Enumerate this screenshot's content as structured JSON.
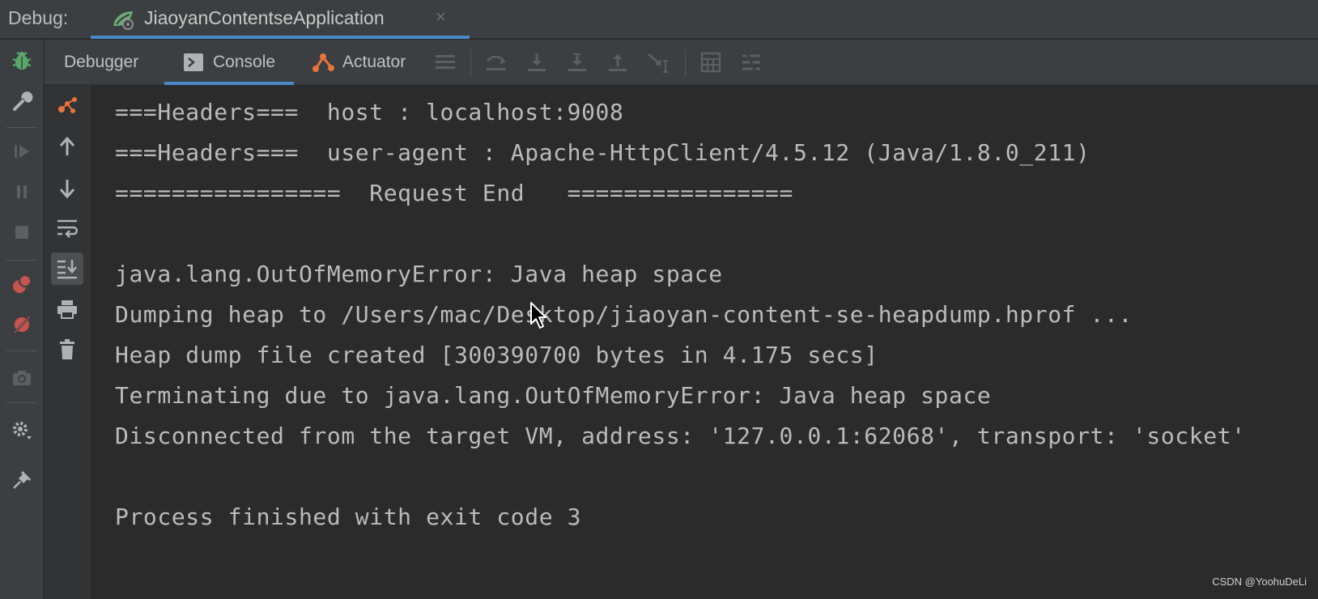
{
  "header": {
    "debug_label": "Debug:",
    "run_config": "JiaoyanContentseApplication",
    "close_symbol": "×"
  },
  "tabs": [
    {
      "label": "Debugger",
      "active": false
    },
    {
      "label": "Console",
      "active": true
    },
    {
      "label": "Actuator",
      "active": false
    }
  ],
  "colors": {
    "accent": "#4a88c7",
    "bug_green": "#59a869",
    "orange": "#e8743b",
    "red": "#c75450"
  },
  "left_toolbar": {
    "icons": [
      "debug-bug-icon",
      "wrench-icon",
      "resume-icon",
      "pause-icon",
      "stop-icon",
      "view-breakpoints-icon",
      "mute-breakpoints-icon",
      "camera-icon",
      "settings-icon",
      "pin-icon"
    ]
  },
  "console": {
    "lines": [
      "===Headers===  host : localhost:9008",
      "===Headers===  user-agent : Apache-HttpClient/4.5.12 (Java/1.8.0_211)",
      "================  Request End   ================",
      "",
      "java.lang.OutOfMemoryError: Java heap space",
      "Dumping heap to /Users/mac/Desktop/jiaoyan-content-se-heapdump.hprof ...",
      "Heap dump file created [300390700 bytes in 4.175 secs]",
      "Terminating due to java.lang.OutOfMemoryError: Java heap space",
      "Disconnected from the target VM, address: '127.0.0.1:62068', transport: 'socket'",
      "",
      "Process finished with exit code 3"
    ]
  },
  "watermark": "CSDN @YoohuDeLi"
}
